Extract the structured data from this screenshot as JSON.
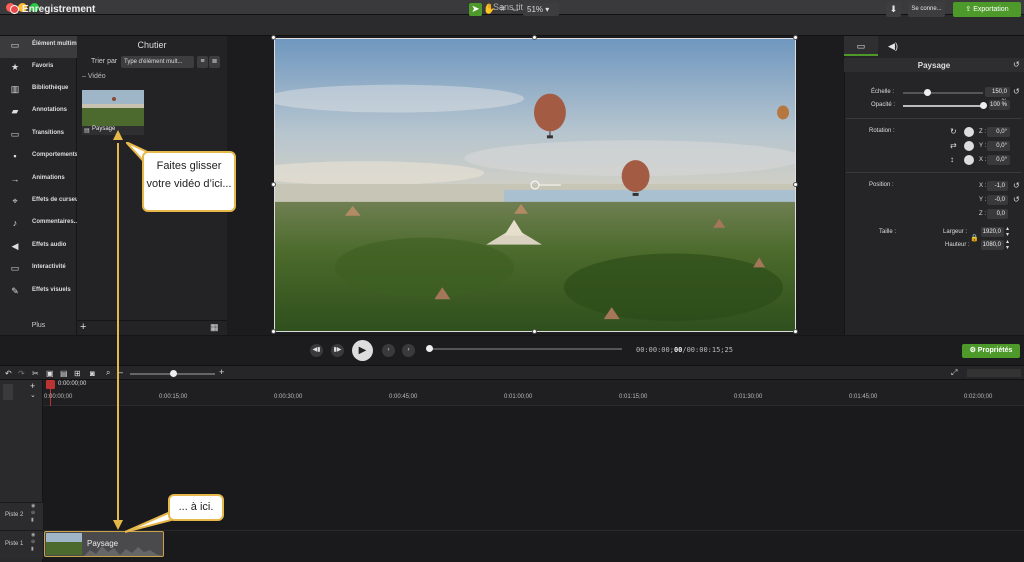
{
  "window": {
    "title": "Sans titre"
  },
  "toolbar": {
    "record_label": "Enregistrement",
    "zoom": "51%",
    "connect_label": "Se conne...",
    "export_label": "Exportation"
  },
  "sidebar": {
    "items": [
      {
        "label": "Élément multim..."
      },
      {
        "label": "Favoris"
      },
      {
        "label": "Bibliothèque"
      },
      {
        "label": "Annotations"
      },
      {
        "label": "Transitions"
      },
      {
        "label": "Comportements"
      },
      {
        "label": "Animations"
      },
      {
        "label": "Effets de curseur"
      },
      {
        "label": "Commentaires..."
      },
      {
        "label": "Effets audio"
      },
      {
        "label": "Interactivité"
      },
      {
        "label": "Effets visuels"
      }
    ],
    "more_label": "Plus"
  },
  "bin": {
    "title": "Chutier",
    "sort_label": "Trier par",
    "sort_value": "Type d'élément mult...",
    "group_label": "Vidéo",
    "item_label": "Paysage"
  },
  "properties": {
    "title": "Paysage",
    "scale_label": "Échelle :",
    "scale_value": "150,0 %",
    "opacity_label": "Opacité :",
    "opacity_value": "100 %",
    "rotation_label": "Rotation :",
    "rot_z_label": "Z :",
    "rot_z": "0,0°",
    "rot_y_label": "Y :",
    "rot_y": "0,0°",
    "rot_x_label": "X :",
    "rot_x": "0,0°",
    "position_label": "Position :",
    "pos_x_label": "X :",
    "pos_x": "-1,0",
    "pos_y_label": "Y :",
    "pos_y": "-0,0",
    "pos_z_label": "Z :",
    "pos_z": "0,0",
    "size_label": "Taille :",
    "width_label": "Largeur :",
    "width_value": "1920,0",
    "height_label": "Hauteur :",
    "height_value": "1080,0",
    "button_label": "Propriétés"
  },
  "player": {
    "time_current": "00:00:00",
    "time_frames": "00",
    "time_total": "00:00:15;25"
  },
  "timeline": {
    "playhead_time": "0:00:00;00",
    "ticks": [
      "0:00:00;00",
      "0:00:15;00",
      "0:00:30;00",
      "0:00:45;00",
      "0:01:00;00",
      "0:01:15;00",
      "0:01:30;00",
      "0:01:45;00",
      "0:02:00;00"
    ],
    "tracks": [
      "Piste 2",
      "Piste 1"
    ],
    "clip_label": "Paysage"
  },
  "callouts": {
    "top": "Faites glisser votre vidéo d’ici...",
    "bottom": "... à ici."
  },
  "colors": {
    "accent_green": "#4d9a2b",
    "callout_border": "#e6b84a",
    "record_red": "#e5484d"
  }
}
